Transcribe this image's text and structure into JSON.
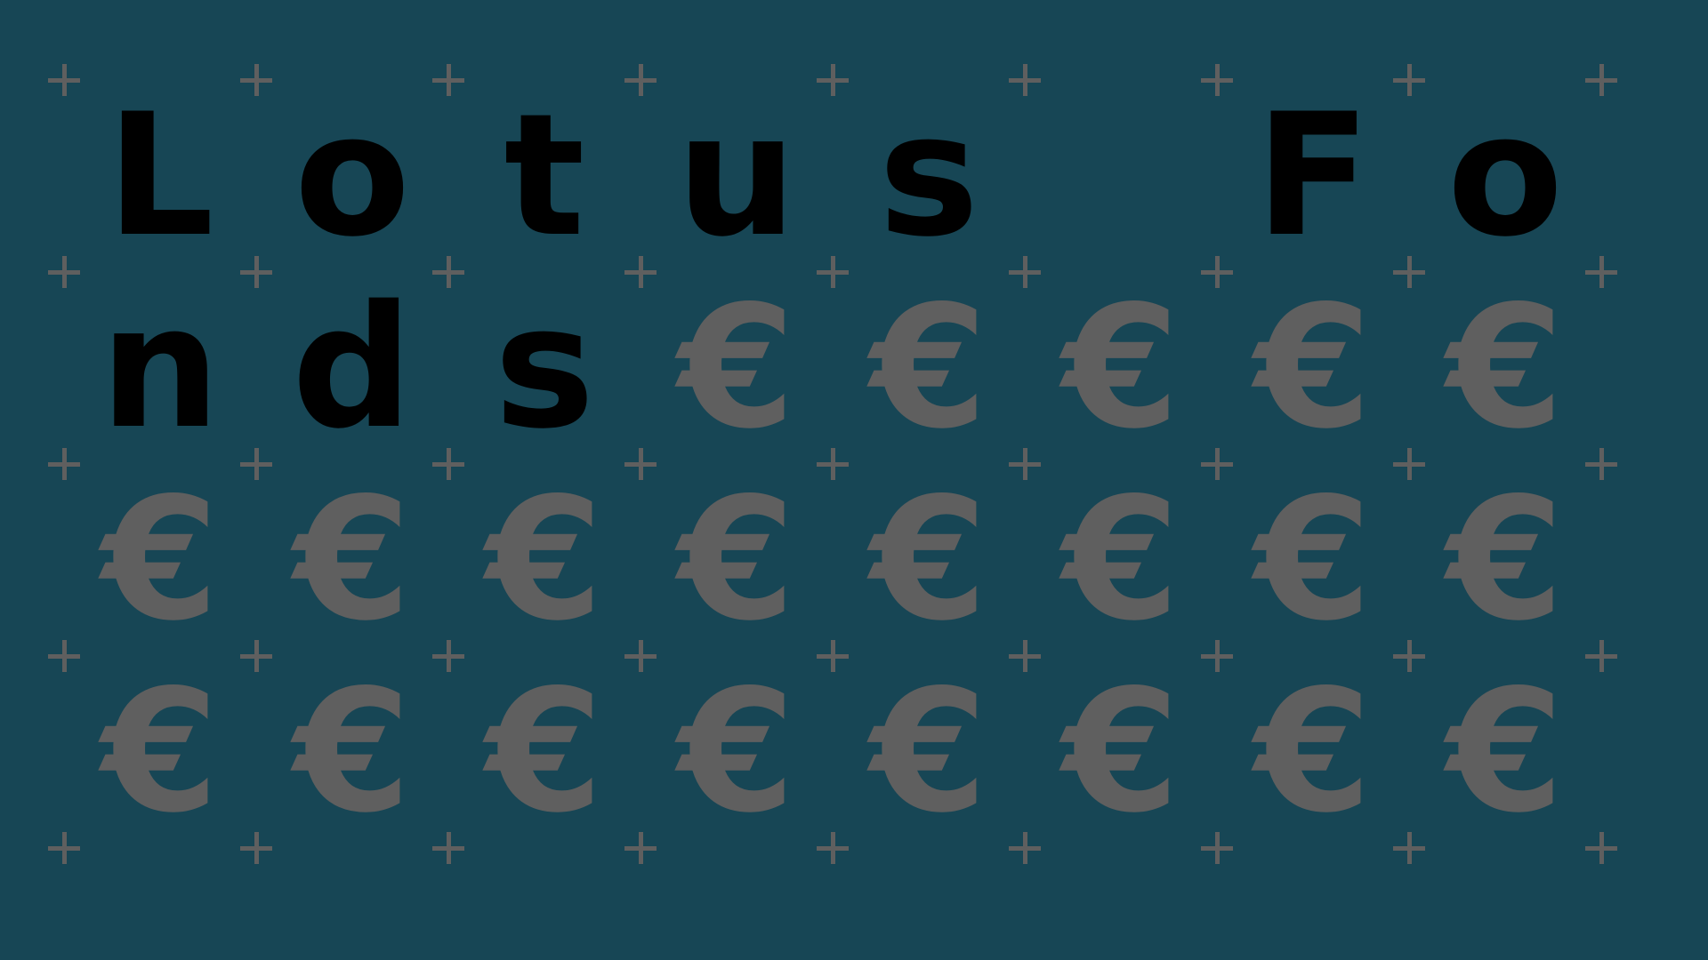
{
  "title": "Lotus Fonds",
  "colors": {
    "background": "#174655",
    "text": "#000000",
    "pattern": "#5f5f5f"
  },
  "pattern": {
    "euro_symbol": "€",
    "plus_symbol": "+"
  }
}
